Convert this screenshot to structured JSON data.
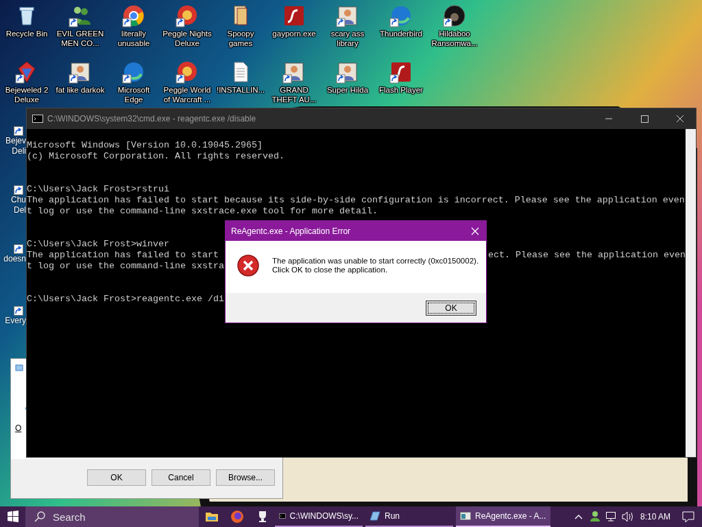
{
  "desktop": {
    "icons": [
      {
        "label": [
          "Recycle Bin"
        ],
        "kind": "bin",
        "shortcut": false
      },
      {
        "label": [
          "EVIL GREEN",
          "MEN CO..."
        ],
        "kind": "people",
        "shortcut": true
      },
      {
        "label": [
          "literally",
          "unusable"
        ],
        "kind": "browser",
        "shortcut": true
      },
      {
        "label": [
          "Peggle Nights",
          "Deluxe"
        ],
        "kind": "ball",
        "shortcut": true
      },
      {
        "label": [
          "Spoopy",
          "games"
        ],
        "kind": "cards",
        "shortcut": false
      },
      {
        "label": [
          "gayporn.exe"
        ],
        "kind": "tile",
        "shortcut": false
      },
      {
        "label": [
          "scary ass",
          "library"
        ],
        "kind": "picture",
        "shortcut": true
      },
      {
        "label": [
          "Thunderbird"
        ],
        "kind": "orb",
        "shortcut": true
      },
      {
        "label": [
          "Hildaboo",
          "Ransomwa..."
        ],
        "kind": "badge",
        "shortcut": true
      },
      {
        "label": [
          "Bejeweled 2",
          "Deluxe"
        ],
        "kind": "gem",
        "shortcut": true
      },
      {
        "label": [
          "fat like darkok"
        ],
        "kind": "picture",
        "shortcut": true
      },
      {
        "label": [
          "Microsoft",
          "Edge"
        ],
        "kind": "orb",
        "shortcut": true
      },
      {
        "label": [
          "Peggle World",
          "of Warcraft ..."
        ],
        "kind": "ball",
        "shortcut": true
      },
      {
        "label": [
          "!INSTALLIN..."
        ],
        "kind": "document",
        "shortcut": false
      },
      {
        "label": [
          "GRAND",
          "THEFT AU..."
        ],
        "kind": "picture",
        "shortcut": true
      },
      {
        "label": [
          "Super Hilda"
        ],
        "kind": "picture",
        "shortcut": true
      },
      {
        "label": [
          "Flash Player"
        ],
        "kind": "tile",
        "shortcut": true
      }
    ],
    "partial_icons": [
      {
        "label": [
          "Bejev",
          "Deli"
        ]
      },
      {
        "label": [
          "Chu",
          "Del"
        ]
      },
      {
        "label": [
          "doesn"
        ]
      },
      {
        "label": [
          "Every"
        ]
      }
    ]
  },
  "run_dialog": {
    "open_label": "O",
    "buttons": [
      "OK",
      "Cancel",
      "Browse..."
    ]
  },
  "console": {
    "title": "C:\\WINDOWS\\system32\\cmd.exe - reagentc.exe  /disable",
    "blocks": [
      [
        {
          "text": "Microsoft Windows [Version 10.0.19045.2965]"
        },
        {
          "text": "(c) Microsoft Corporation. All rights reserved."
        }
      ],
      [
        {
          "text": "C:\\Users\\Jack Frost>rstrui"
        },
        {
          "text": "The application has failed to start because its side-by-side configuration is incorrect. Please see the application even"
        },
        {
          "text": "t log or use the command-line sxstrace.exe tool for more detail."
        }
      ],
      [
        {
          "text": "C:\\Users\\Jack Frost>winver"
        },
        {
          "text": "The application has failed to start",
          "text_right": "ect. Please see the application even"
        },
        {
          "text": "t log or use the command-line sxstra"
        }
      ],
      [
        {
          "text": "C:\\Users\\Jack Frost>reagentc.exe /di"
        }
      ]
    ]
  },
  "error_dialog": {
    "title": "ReAgentc.exe - Application Error",
    "message": "The application was unable to start correctly (0xc0150002).\nClick OK to close the application.",
    "button": "OK"
  },
  "taskbar": {
    "search": {
      "placeholder": "Search"
    },
    "pinned": [
      {
        "kind": "folder"
      },
      {
        "kind": "fox"
      },
      {
        "kind": "trophy"
      }
    ],
    "tasks": [
      {
        "label": "C:\\WINDOWS\\sy...",
        "kind": "console",
        "selected": false
      },
      {
        "label": "Run",
        "kind": "run",
        "selected": false
      },
      {
        "label": "ReAgentc.exe - A...",
        "kind": "error",
        "selected": true
      }
    ],
    "clock": "8:10 AM"
  }
}
